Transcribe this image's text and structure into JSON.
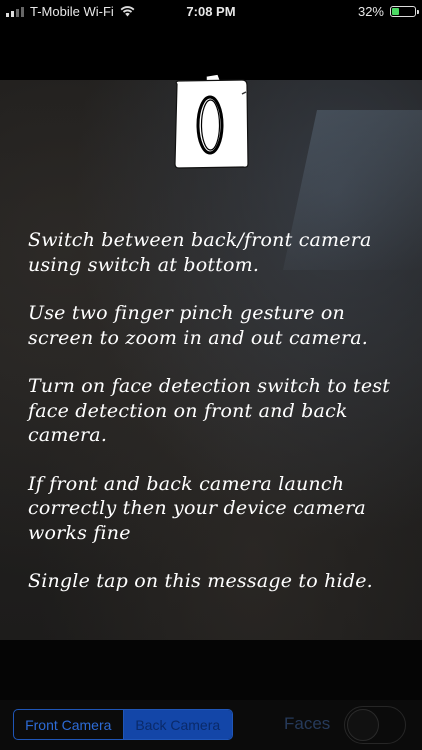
{
  "status_bar": {
    "carrier": "T-Mobile Wi-Fi",
    "time": "7:08 PM",
    "battery_percent": "32%",
    "battery_level": 0.32,
    "icons": [
      "signal-icon",
      "wifi-icon",
      "battery-icon"
    ]
  },
  "overlay": {
    "icon": "camera-icon",
    "messages": [
      "Switch between back/front camera using switch at bottom.",
      "Use two finger pinch gesture on screen to zoom in and out camera.",
      "Turn on face detection switch to test face detection on front and back camera.",
      "If front and back camera launch correctly then your device camera works fine",
      "Single tap on this message to hide."
    ]
  },
  "toolbar": {
    "segments": [
      "Front Camera",
      "Back Camera"
    ],
    "selected": "Back Camera",
    "faces_label": "Faces",
    "faces_switch_on": false
  },
  "colors": {
    "accent": "#1346a8",
    "battery_fill": "#4cd964"
  }
}
